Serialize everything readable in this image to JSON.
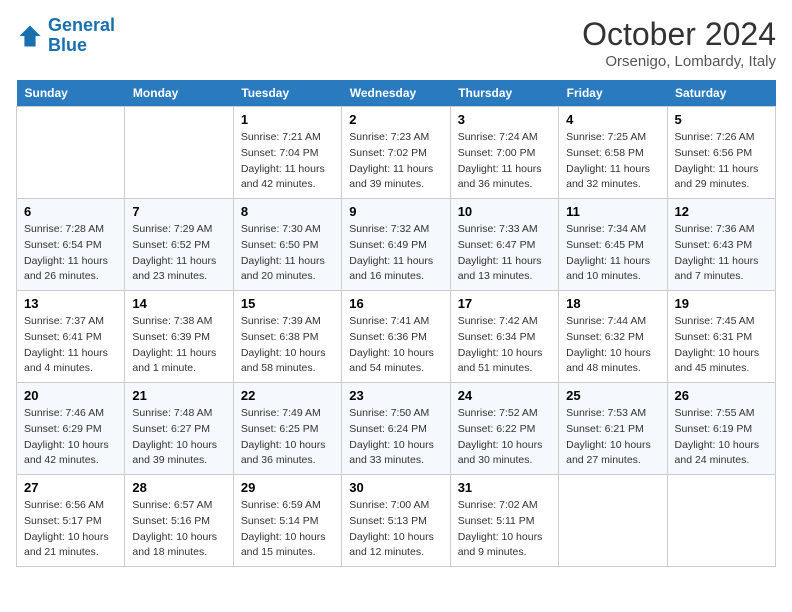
{
  "header": {
    "logo_line1": "General",
    "logo_line2": "Blue",
    "month_title": "October 2024",
    "location": "Orsenigo, Lombardy, Italy"
  },
  "weekdays": [
    "Sunday",
    "Monday",
    "Tuesday",
    "Wednesday",
    "Thursday",
    "Friday",
    "Saturday"
  ],
  "weeks": [
    [
      {
        "day": "",
        "info": ""
      },
      {
        "day": "",
        "info": ""
      },
      {
        "day": "1",
        "info": "Sunrise: 7:21 AM\nSunset: 7:04 PM\nDaylight: 11 hours and 42 minutes."
      },
      {
        "day": "2",
        "info": "Sunrise: 7:23 AM\nSunset: 7:02 PM\nDaylight: 11 hours and 39 minutes."
      },
      {
        "day": "3",
        "info": "Sunrise: 7:24 AM\nSunset: 7:00 PM\nDaylight: 11 hours and 36 minutes."
      },
      {
        "day": "4",
        "info": "Sunrise: 7:25 AM\nSunset: 6:58 PM\nDaylight: 11 hours and 32 minutes."
      },
      {
        "day": "5",
        "info": "Sunrise: 7:26 AM\nSunset: 6:56 PM\nDaylight: 11 hours and 29 minutes."
      }
    ],
    [
      {
        "day": "6",
        "info": "Sunrise: 7:28 AM\nSunset: 6:54 PM\nDaylight: 11 hours and 26 minutes."
      },
      {
        "day": "7",
        "info": "Sunrise: 7:29 AM\nSunset: 6:52 PM\nDaylight: 11 hours and 23 minutes."
      },
      {
        "day": "8",
        "info": "Sunrise: 7:30 AM\nSunset: 6:50 PM\nDaylight: 11 hours and 20 minutes."
      },
      {
        "day": "9",
        "info": "Sunrise: 7:32 AM\nSunset: 6:49 PM\nDaylight: 11 hours and 16 minutes."
      },
      {
        "day": "10",
        "info": "Sunrise: 7:33 AM\nSunset: 6:47 PM\nDaylight: 11 hours and 13 minutes."
      },
      {
        "day": "11",
        "info": "Sunrise: 7:34 AM\nSunset: 6:45 PM\nDaylight: 11 hours and 10 minutes."
      },
      {
        "day": "12",
        "info": "Sunrise: 7:36 AM\nSunset: 6:43 PM\nDaylight: 11 hours and 7 minutes."
      }
    ],
    [
      {
        "day": "13",
        "info": "Sunrise: 7:37 AM\nSunset: 6:41 PM\nDaylight: 11 hours and 4 minutes."
      },
      {
        "day": "14",
        "info": "Sunrise: 7:38 AM\nSunset: 6:39 PM\nDaylight: 11 hours and 1 minute."
      },
      {
        "day": "15",
        "info": "Sunrise: 7:39 AM\nSunset: 6:38 PM\nDaylight: 10 hours and 58 minutes."
      },
      {
        "day": "16",
        "info": "Sunrise: 7:41 AM\nSunset: 6:36 PM\nDaylight: 10 hours and 54 minutes."
      },
      {
        "day": "17",
        "info": "Sunrise: 7:42 AM\nSunset: 6:34 PM\nDaylight: 10 hours and 51 minutes."
      },
      {
        "day": "18",
        "info": "Sunrise: 7:44 AM\nSunset: 6:32 PM\nDaylight: 10 hours and 48 minutes."
      },
      {
        "day": "19",
        "info": "Sunrise: 7:45 AM\nSunset: 6:31 PM\nDaylight: 10 hours and 45 minutes."
      }
    ],
    [
      {
        "day": "20",
        "info": "Sunrise: 7:46 AM\nSunset: 6:29 PM\nDaylight: 10 hours and 42 minutes."
      },
      {
        "day": "21",
        "info": "Sunrise: 7:48 AM\nSunset: 6:27 PM\nDaylight: 10 hours and 39 minutes."
      },
      {
        "day": "22",
        "info": "Sunrise: 7:49 AM\nSunset: 6:25 PM\nDaylight: 10 hours and 36 minutes."
      },
      {
        "day": "23",
        "info": "Sunrise: 7:50 AM\nSunset: 6:24 PM\nDaylight: 10 hours and 33 minutes."
      },
      {
        "day": "24",
        "info": "Sunrise: 7:52 AM\nSunset: 6:22 PM\nDaylight: 10 hours and 30 minutes."
      },
      {
        "day": "25",
        "info": "Sunrise: 7:53 AM\nSunset: 6:21 PM\nDaylight: 10 hours and 27 minutes."
      },
      {
        "day": "26",
        "info": "Sunrise: 7:55 AM\nSunset: 6:19 PM\nDaylight: 10 hours and 24 minutes."
      }
    ],
    [
      {
        "day": "27",
        "info": "Sunrise: 6:56 AM\nSunset: 5:17 PM\nDaylight: 10 hours and 21 minutes."
      },
      {
        "day": "28",
        "info": "Sunrise: 6:57 AM\nSunset: 5:16 PM\nDaylight: 10 hours and 18 minutes."
      },
      {
        "day": "29",
        "info": "Sunrise: 6:59 AM\nSunset: 5:14 PM\nDaylight: 10 hours and 15 minutes."
      },
      {
        "day": "30",
        "info": "Sunrise: 7:00 AM\nSunset: 5:13 PM\nDaylight: 10 hours and 12 minutes."
      },
      {
        "day": "31",
        "info": "Sunrise: 7:02 AM\nSunset: 5:11 PM\nDaylight: 10 hours and 9 minutes."
      },
      {
        "day": "",
        "info": ""
      },
      {
        "day": "",
        "info": ""
      }
    ]
  ]
}
